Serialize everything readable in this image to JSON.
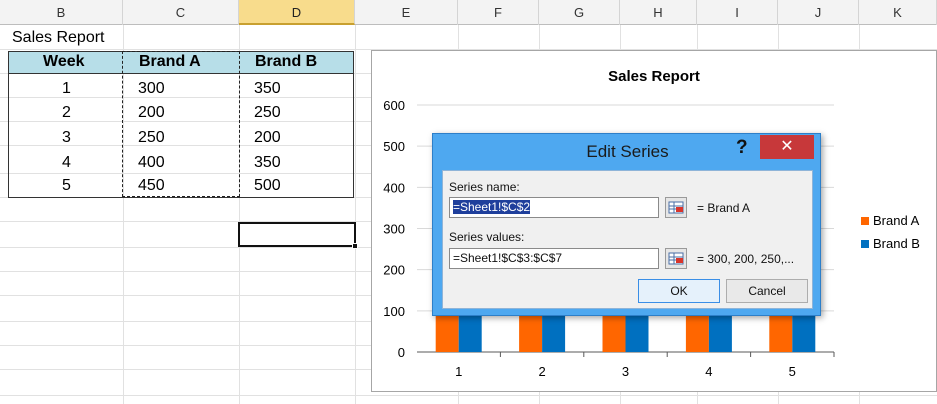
{
  "columns": [
    "B",
    "C",
    "D",
    "E",
    "F",
    "G",
    "H",
    "I",
    "J",
    "K"
  ],
  "sheet": {
    "title": "Sales Report",
    "table": {
      "headers": [
        "Week",
        "Brand A",
        "Brand B"
      ],
      "rows": [
        [
          "1",
          "300",
          "350"
        ],
        [
          "2",
          "200",
          "250"
        ],
        [
          "3",
          "250",
          "200"
        ],
        [
          "4",
          "400",
          "350"
        ],
        [
          "5",
          "450",
          "500"
        ]
      ]
    }
  },
  "chart": {
    "title": "Sales Report",
    "y_ticks": [
      "0",
      "100",
      "200",
      "300",
      "400",
      "500",
      "600"
    ],
    "legend": [
      "Brand A",
      "Brand B"
    ]
  },
  "chart_data": {
    "type": "bar",
    "title": "Sales Report",
    "categories": [
      "1",
      "2",
      "3",
      "4",
      "5"
    ],
    "series": [
      {
        "name": "Brand A",
        "values": [
          300,
          200,
          250,
          400,
          450
        ],
        "color": "#ff6600"
      },
      {
        "name": "Brand B",
        "values": [
          350,
          250,
          200,
          350,
          500
        ],
        "color": "#0070c0"
      }
    ],
    "ylim": [
      0,
      600
    ],
    "yticks": [
      0,
      100,
      200,
      300,
      400,
      500,
      600
    ],
    "legend": "right"
  },
  "dialog": {
    "title": "Edit Series",
    "help": "?",
    "close": "✕",
    "series_name_label": "Series name:",
    "series_name_value": "=Sheet1!$C$2",
    "series_name_result": "= Brand A",
    "series_values_label": "Series values:",
    "series_values_value": "=Sheet1!$C$3:$C$7",
    "series_values_result": "= 300, 200, 250,...",
    "ok": "OK",
    "cancel": "Cancel"
  },
  "colors": {
    "header_fill": "#b7dee8",
    "dialog_frame": "#4ea8f0",
    "close_button": "#c7383a",
    "brand_a": "#ff6600",
    "brand_b": "#0070c0"
  }
}
